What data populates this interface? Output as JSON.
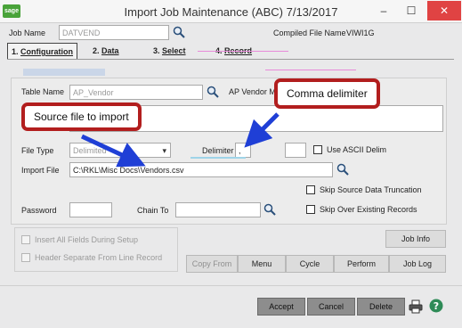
{
  "window": {
    "logo": "sage",
    "title": "Import Job Maintenance (ABC) 7/13/2017",
    "minimize": "–",
    "maximize": "☐",
    "close": "✕"
  },
  "header": {
    "job_name_label": "Job Name",
    "job_name_value": "DATVEND",
    "compiled_label": "Compiled File Name",
    "compiled_value": "VIWI1G"
  },
  "tabs": [
    {
      "num": "1.",
      "label": "Configuration"
    },
    {
      "num": "2.",
      "label": "Data"
    },
    {
      "num": "3.",
      "label": "Select"
    },
    {
      "num": "4.",
      "label": "Record"
    }
  ],
  "form": {
    "table_name_label": "Table Name",
    "table_name_value": "AP_Vendor",
    "table_desc_prefix": "AP Vendor M",
    "file_type_label": "File Type",
    "file_type_value": "Delimited",
    "delimiter_label": "Delimiter",
    "delimiter_value": ",",
    "use_ascii_label": "Use ASCII Delim",
    "import_file_label": "Import File",
    "import_file_value": "C:\\RKL\\Misc Docs\\Vendors.csv",
    "skip_truncation_label": "Skip Source Data Truncation",
    "password_label": "Password",
    "chain_to_label": "Chain To",
    "skip_existing_label": "Skip Over Existing Records"
  },
  "options": {
    "insert_all_label": "Insert All Fields During Setup",
    "header_separate_label": "Header Separate From Line Record"
  },
  "buttons": {
    "job_info": "Job Info",
    "copy_from": "Copy From",
    "menu": "Menu",
    "cycle": "Cycle",
    "perform": "Perform",
    "job_log": "Job Log",
    "accept": "Accept",
    "cancel": "Cancel",
    "delete": "Delete"
  },
  "annotations": {
    "source_callout": "Source file to import",
    "comma_callout": "Comma delimiter",
    "callout_color": "#b21e1e",
    "arrow_color": "#1f3fd6"
  }
}
